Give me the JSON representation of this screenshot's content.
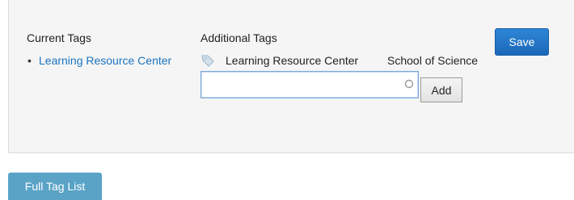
{
  "current_tags": {
    "heading": "Current Tags",
    "items": [
      {
        "label": "Learning Resource Center"
      }
    ]
  },
  "additional_tags": {
    "heading": "Additional Tags",
    "icon": "tag-icon",
    "suggestions": [
      {
        "label": "Learning Resource Center"
      },
      {
        "label": "School of Science"
      }
    ],
    "input": {
      "value": "",
      "placeholder": ""
    },
    "add_label": "Add"
  },
  "toolbar": {
    "save_label": "Save"
  },
  "footer": {
    "full_tag_list_label": "Full Tag List"
  },
  "colors": {
    "link": "#1a73c0",
    "save_button": "#1b67b8",
    "full_tag_list_button": "#5aa3c6",
    "panel_background": "#f5f5f5"
  }
}
